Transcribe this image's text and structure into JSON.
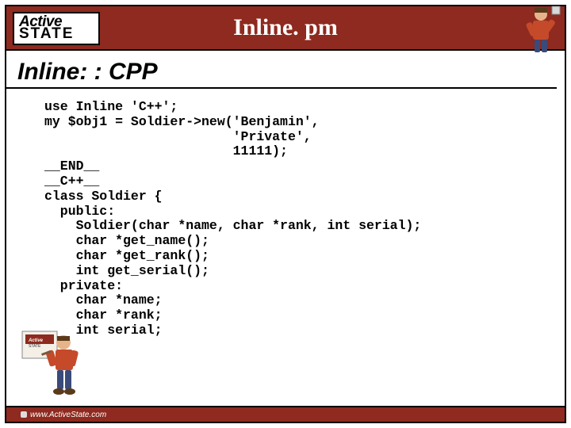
{
  "logo": {
    "line1": "Active",
    "line2": "STATE"
  },
  "title": "Inline. pm",
  "subtitle": "Inline: : CPP",
  "code": "use Inline 'C++';\nmy $obj1 = Soldier->new('Benjamin',\n                        'Private',\n                        11111);\n__END__\n__C++__\nclass Soldier {\n  public:\n    Soldier(char *name, char *rank, int serial);\n    char *get_name();\n    char *get_rank();\n    int get_serial();\n  private:\n    char *name;\n    char *rank;\n    int serial;\n};",
  "footer": {
    "url": "www.ActiveState.com"
  },
  "mascot": {
    "top_name": "mascot-figure-top",
    "bottom_name": "mascot-figure-bottom"
  }
}
